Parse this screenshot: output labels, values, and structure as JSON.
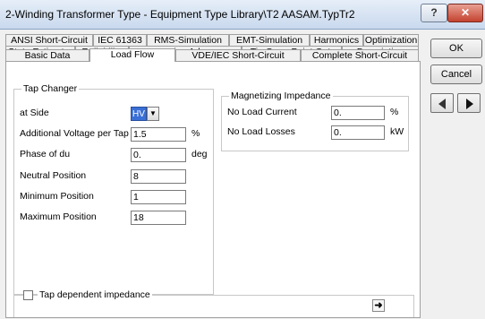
{
  "window": {
    "title": "2-Winding Transformer Type - Equipment Type Library\\T2 AASAM.TypTr2",
    "help_label": "?",
    "close_label": "✕"
  },
  "tabs": {
    "row1": [
      "ANSI Short-Circuit",
      "IEC 61363",
      "RMS-Simulation",
      "EMT-Simulation",
      "Harmonics",
      "Optimization"
    ],
    "row2": [
      "State Estimator",
      "Reliability",
      "Generation Adequacy",
      "Tie Open Point Opt.",
      "Description"
    ],
    "row3": [
      "Basic Data",
      "Load Flow",
      "VDE/IEC Short-Circuit",
      "Complete Short-Circuit"
    ],
    "active": "Load Flow"
  },
  "tap_changer": {
    "title": "Tap Changer",
    "at_side_label": "at Side",
    "at_side_value": "HV",
    "add_voltage_label": "Additional Voltage per Tap",
    "add_voltage_value": "1.5",
    "add_voltage_unit": "%",
    "phase_label": "Phase of du",
    "phase_value": "0.",
    "phase_unit": "deg",
    "neutral_label": "Neutral Position",
    "neutral_value": "8",
    "min_label": "Minimum Position",
    "min_value": "1",
    "max_label": "Maximum Position",
    "max_value": "18"
  },
  "magnetizing": {
    "title": "Magnetizing Impedance",
    "noload_current_label": "No Load Current",
    "noload_current_value": "0.",
    "noload_current_unit": "%",
    "noload_losses_label": "No Load Losses",
    "noload_losses_value": "0.",
    "noload_losses_unit": "kW"
  },
  "tap_dependent": {
    "label": "Tap dependent impedance",
    "arrow": "➜"
  },
  "buttons": {
    "ok": "OK",
    "cancel": "Cancel"
  }
}
